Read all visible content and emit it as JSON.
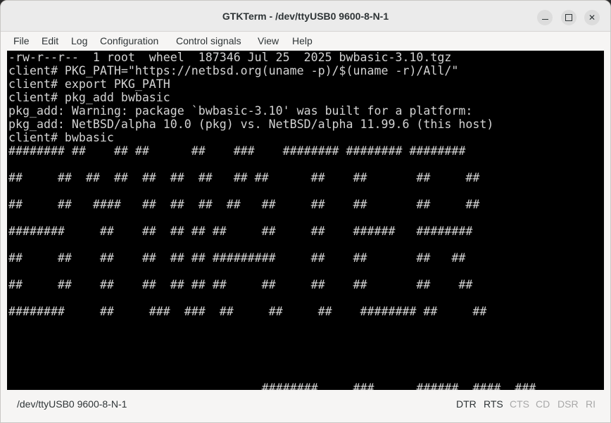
{
  "window": {
    "title": "GTKTerm - /dev/ttyUSB0  9600-8-N-1"
  },
  "menubar": {
    "items": [
      "File",
      "Edit",
      "Log",
      "Configuration",
      "Control signals",
      "View",
      "Help"
    ]
  },
  "terminal": {
    "lines": [
      "-rw-r--r--  1 root  wheel  187346 Jul 25  2025 bwbasic-3.10.tgz",
      "client# PKG_PATH=\"https://netbsd.org(uname -p)/$(uname -r)/All/\"",
      "client# export PKG_PATH",
      "client# pkg_add bwbasic",
      "pkg_add: Warning: package `bwbasic-3.10' was built for a platform:",
      "pkg_add: NetBSD/alpha 10.0 (pkg) vs. NetBSD/alpha 11.99.6 (this host)",
      "client# bwbasic",
      "######## ##    ## ##      ##    ###    ######## ######## ########",
      "",
      "##     ##  ##  ##  ##  ##  ##   ## ##      ##    ##       ##     ##",
      "",
      "##     ##   ####   ##  ##  ##  ##   ##     ##    ##       ##     ##",
      "",
      "########     ##    ##  ## ## ##     ##     ##    ######   ########",
      "",
      "##     ##    ##    ##  ## ## #########     ##    ##       ##   ##",
      "",
      "##     ##    ##    ##  ## ## ##     ##     ##    ##       ##    ##",
      "",
      "########     ##     ###  ###  ##     ##     ##    ######## ##     ##"
    ],
    "partial_line": "                                    ########     ###      ######  ####  ###"
  },
  "statusbar": {
    "port": "/dev/ttyUSB0  9600-8-N-1",
    "signals": [
      {
        "label": "DTR",
        "active": true
      },
      {
        "label": "RTS",
        "active": true
      },
      {
        "label": "CTS",
        "active": false
      },
      {
        "label": "CD",
        "active": false
      },
      {
        "label": "DSR",
        "active": false
      },
      {
        "label": "RI",
        "active": false
      }
    ]
  }
}
